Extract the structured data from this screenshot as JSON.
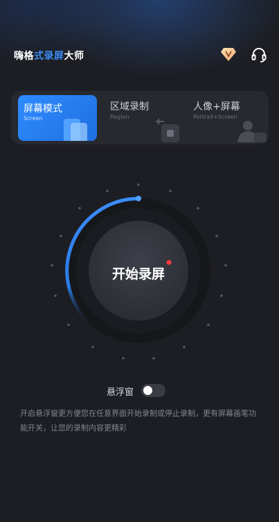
{
  "app": {
    "title_parts": [
      "嗨格",
      "式",
      "录屏",
      "大",
      "师"
    ],
    "icons": {
      "vip": "diamond-icon",
      "support": "headset-icon"
    }
  },
  "tabs": [
    {
      "label": "屏幕模式",
      "sub": "Screen",
      "active": true
    },
    {
      "label": "区域录制",
      "sub": "Region",
      "active": false
    },
    {
      "label": "人像+屏幕",
      "sub": "Portrait+Screen",
      "active": false
    }
  ],
  "record": {
    "start_label": "开始录屏",
    "indicator_color": "#ff3b3b"
  },
  "float_window": {
    "label": "悬浮窗",
    "enabled": false
  },
  "description": "开启悬浮窗更方便您在任意界面开始录制或停止录制，更有屏幕画笔功能开关，让您的录制内容更精彩",
  "colors": {
    "accent": "#2e8cff",
    "background": "#1d1e23"
  }
}
